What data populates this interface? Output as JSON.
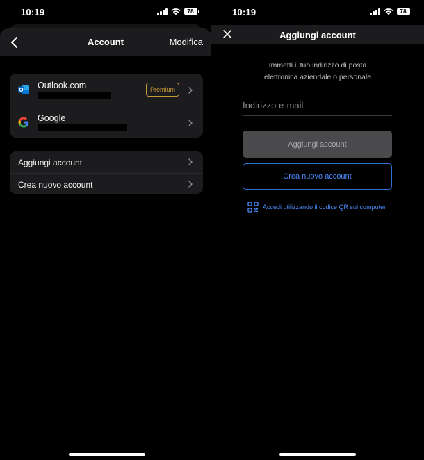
{
  "left_screen": {
    "status": {
      "time": "10:19",
      "battery": "78"
    },
    "header": {
      "title": "Account",
      "edit_label": "Modifica"
    },
    "accounts": [
      {
        "name": "Outlook.com",
        "badge": "Premium",
        "icon": "outlook-icon"
      },
      {
        "name": "Google",
        "icon": "google-icon"
      }
    ],
    "actions": [
      {
        "label": "Aggiungi account"
      },
      {
        "label": "Crea nuovo account"
      }
    ]
  },
  "right_screen": {
    "status": {
      "time": "10:19",
      "battery": "78"
    },
    "header": {
      "title": "Aggiungi account"
    },
    "intro_line1": "Immetti il tuo indirizzo di posta",
    "intro_line2": "elettronica aziendale o personale",
    "email": {
      "placeholder": "Indirizzo e-mail",
      "value": ""
    },
    "add_button": "Aggiungi account",
    "create_button": "Crea nuovo account",
    "qr_link": "Accedi utilizzando il codice QR sul computer"
  },
  "colors": {
    "accent": "#4c8dff",
    "premium": "#c79a33",
    "surface": "#1c1c1e"
  }
}
